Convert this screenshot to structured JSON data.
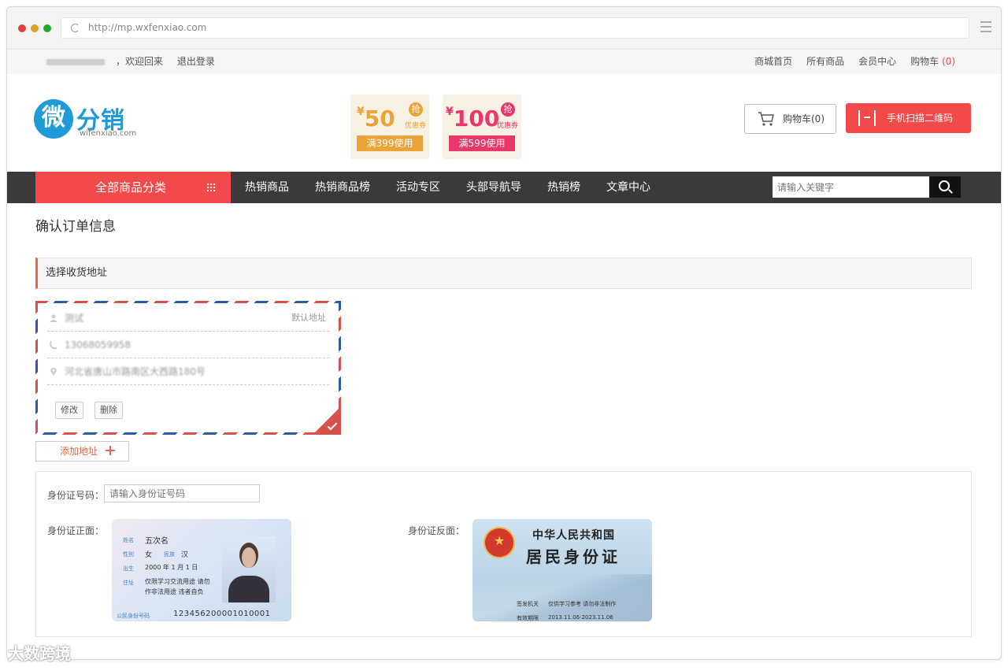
{
  "browser": {
    "url": "http://mp.wxfenxiao.com",
    "dot_colors": [
      "#e0443e",
      "#dea123",
      "#1aab29"
    ]
  },
  "topbar": {
    "welcome": "，欢迎回来",
    "logout": "退出登录",
    "links": [
      "商城首页",
      "所有商品",
      "会员中心"
    ],
    "cart_label": "购物车",
    "cart_count": "(0)"
  },
  "logo": {
    "mark": "微",
    "name": "分销",
    "domain": "wifenxiao.com"
  },
  "coupons": [
    {
      "currency": "¥",
      "amount": "50",
      "badge": "抢",
      "tag": "优惠券",
      "condition": "满399使用",
      "color": "#e9a43a"
    },
    {
      "currency": "¥",
      "amount": "100",
      "badge": "抢",
      "tag": "优惠券",
      "condition": "满599使用",
      "color": "#e8376a"
    }
  ],
  "header": {
    "cart_button": "购物车(0)",
    "qr_button": "手机扫描二维码"
  },
  "nav": {
    "category": "全部商品分类",
    "links": [
      "热销商品",
      "热销商品榜",
      "活动专区",
      "头部导航导",
      "热销榜",
      "文章中心"
    ],
    "search_placeholder": "请输入关键字"
  },
  "order": {
    "title": "确认订单信息",
    "section_address": "选择收货地址",
    "address": {
      "name": "测试",
      "default_label": "默认地址",
      "phone": "13068059958",
      "location": "河北省唐山市路南区大西路180号",
      "edit": "修改",
      "delete": "删除"
    },
    "add_address": "添加地址"
  },
  "id_section": {
    "number_label": "身份证号码：",
    "number_placeholder": "请输入身份证号码",
    "front_label": "身份证正面：",
    "back_label": "身份证反面："
  },
  "id_front": {
    "name_key": "姓名",
    "name": "五次名",
    "sex_key": "性别",
    "sex": "女",
    "ethnic_key": "民族",
    "ethnic": "汉",
    "birth_key": "出生",
    "birth": "2000 年 1 月 1 日",
    "addr_key": "住址",
    "addr_line1": "仅限学习交流用途 请勿",
    "addr_line2": "作非法用途 违者自负",
    "id_key": "公民身份号码",
    "id_number": "123456200001010001"
  },
  "id_back": {
    "country": "中华人民共和国",
    "title": "居民身份证",
    "issuer_key": "签发机关",
    "issuer": "仅供学习参考 请勿非法制作",
    "valid_key": "有效期限",
    "valid": "2013.11.06-2023.11.06"
  },
  "watermark": "大数跨境",
  "colors": {
    "accent": "#f24a4a",
    "nav_bg": "#3a3a3a",
    "logo_blue": "#1e9ad6"
  }
}
